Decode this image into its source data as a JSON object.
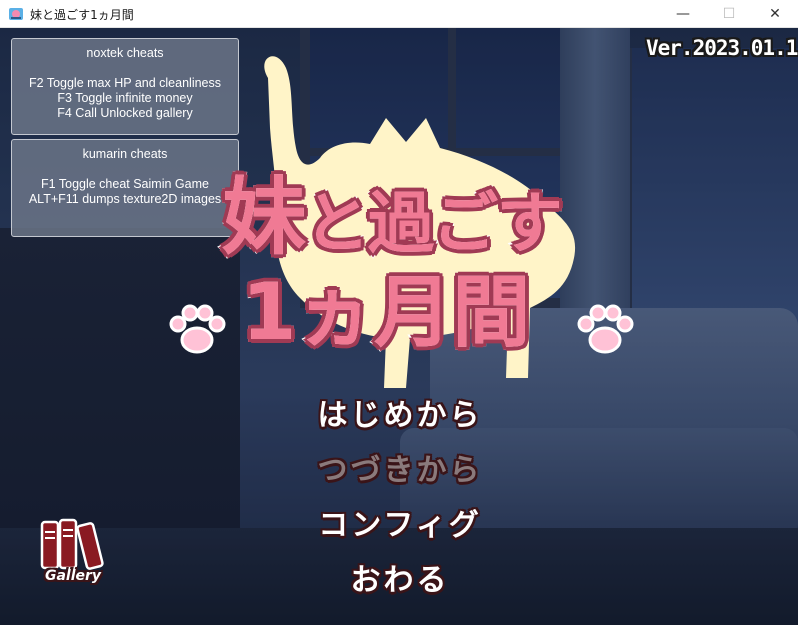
{
  "window": {
    "title": "妹と過ごす1ヵ月間",
    "min_glyph": "—",
    "max_glyph": "☐",
    "close_glyph": "✕"
  },
  "game": {
    "version": "Ver.2023.01.1",
    "logo": {
      "line1_big": "妹",
      "line1_rest": "と過ごす",
      "line2": "1ヵ月間"
    },
    "cheats": [
      {
        "title": "noxtek cheats",
        "lines": [
          "F2 Toggle max HP and cleanliness",
          "F3 Toggle infinite money",
          "F4 Call Unlocked gallery"
        ]
      },
      {
        "title": "kumarin cheats",
        "lines": [
          "F1 Toggle cheat Saimin Game",
          "ALT+F11 dumps texture2D images"
        ]
      }
    ],
    "menu": {
      "new_game": "はじめから",
      "continue": "つづきから",
      "config": "コンフィグ",
      "quit": "おわる"
    },
    "gallery_label": "Gallery"
  },
  "colors": {
    "logo_fill": "#f07a94",
    "logo_outline": "#a03a54",
    "cat": "#fff4c8",
    "paw": "#ffc2d6",
    "menu_outline": "#3a1418",
    "book": "#8a1a22"
  },
  "icons": [
    "app-icon",
    "paw-icon",
    "gallery-books-icon"
  ]
}
